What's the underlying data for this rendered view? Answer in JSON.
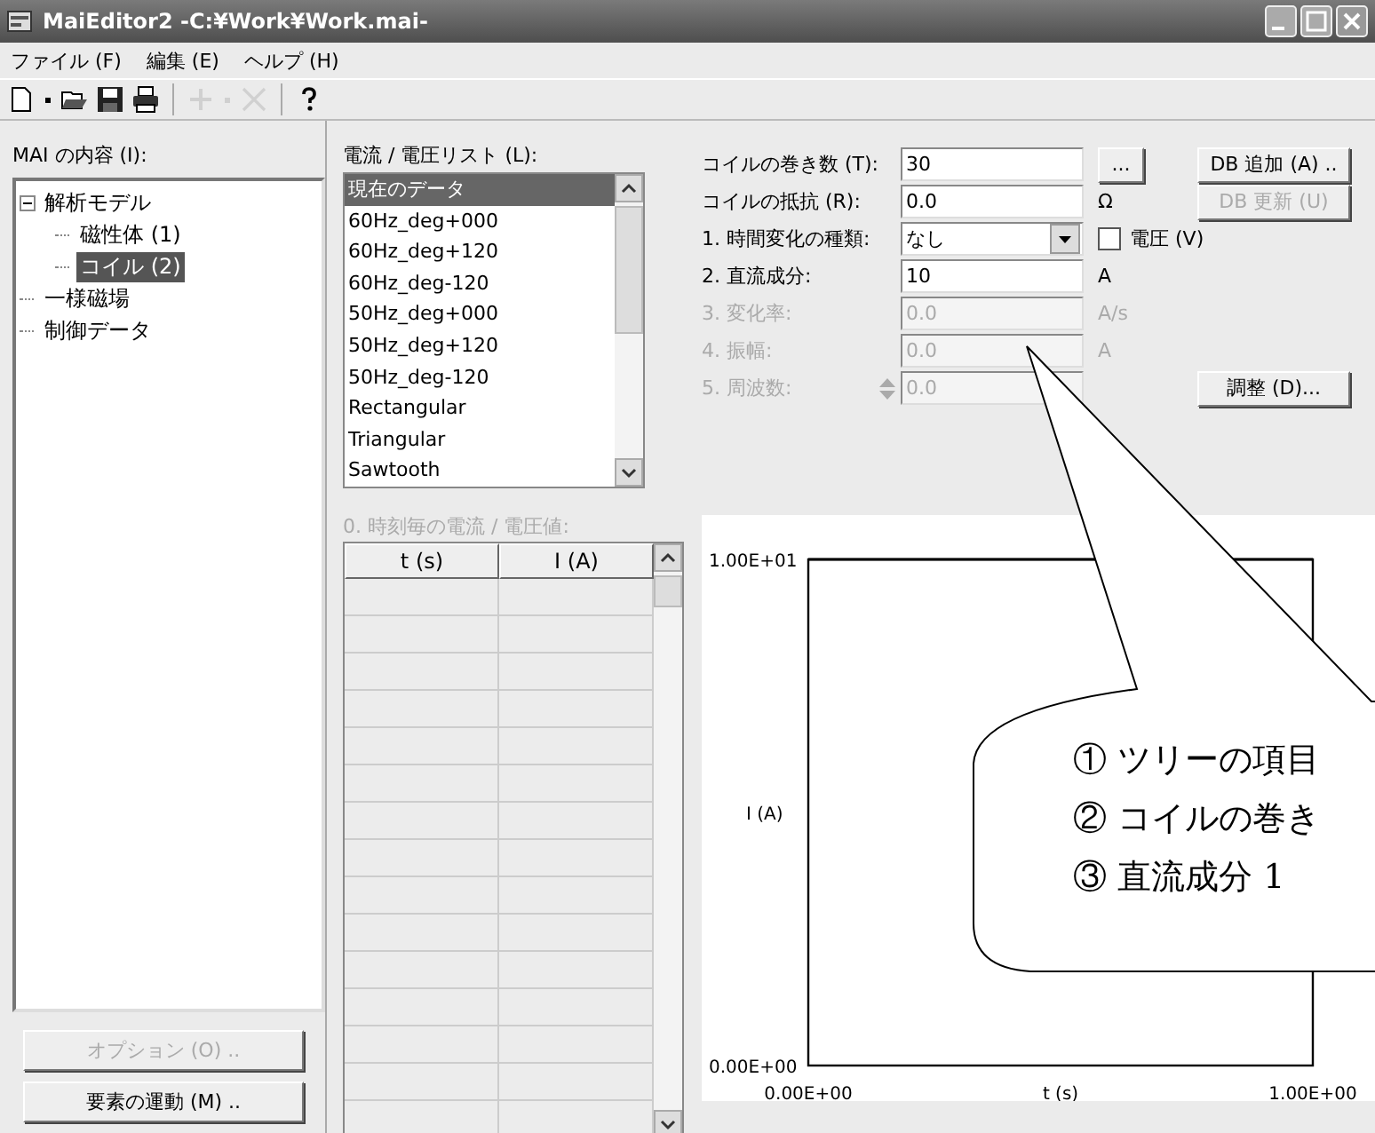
{
  "window": {
    "title": "MaiEditor2 -C:¥Work¥Work.mai-"
  },
  "menu": [
    {
      "label": "ファイル (F)"
    },
    {
      "label": "編集 (E)"
    },
    {
      "label": "ヘルプ (H)"
    }
  ],
  "toolbar": [
    {
      "kind": "new",
      "disabled": false
    },
    {
      "kind": "dropdown",
      "disabled": false
    },
    {
      "kind": "open",
      "disabled": false
    },
    {
      "kind": "save",
      "disabled": false
    },
    {
      "kind": "print",
      "disabled": false
    },
    {
      "kind": "separator"
    },
    {
      "kind": "add",
      "disabled": true
    },
    {
      "kind": "dropdown",
      "disabled": true
    },
    {
      "kind": "delete",
      "disabled": true
    },
    {
      "kind": "separator"
    },
    {
      "kind": "help",
      "disabled": false
    }
  ],
  "tree": {
    "label": "MAI の内容 (I):",
    "items": [
      {
        "label": "解析モデル",
        "expanded": true,
        "selected": false,
        "children": [
          {
            "label": "磁性体 (1)",
            "selected": false
          },
          {
            "label": "コイル (2)",
            "selected": true
          }
        ]
      },
      {
        "label": "一様磁場",
        "selected": false
      },
      {
        "label": "制御データ",
        "selected": false
      }
    ]
  },
  "left_buttons": [
    {
      "label": "オプション (O) ..",
      "disabled": true
    },
    {
      "label": "要素の運動 (M) ..",
      "disabled": false
    }
  ],
  "list": {
    "label": "電流 / 電圧リスト (L):",
    "items": [
      {
        "label": "現在のデータ",
        "selected": true
      },
      {
        "label": "60Hz_deg+000",
        "selected": false
      },
      {
        "label": "60Hz_deg+120",
        "selected": false
      },
      {
        "label": "60Hz_deg-120",
        "selected": false
      },
      {
        "label": "50Hz_deg+000",
        "selected": false
      },
      {
        "label": "50Hz_deg+120",
        "selected": false
      },
      {
        "label": "50Hz_deg-120",
        "selected": false
      },
      {
        "label": "Rectangular",
        "selected": false
      },
      {
        "label": "Triangular",
        "selected": false
      },
      {
        "label": "Sawtooth",
        "selected": false
      }
    ]
  },
  "form": {
    "rows": [
      {
        "kind": "text",
        "label": "コイルの巻き数 (T):",
        "value": "30",
        "disabled": false,
        "extra": {
          "kind": "button",
          "label": "..."
        },
        "side_button": {
          "label": "DB 追加 (A) ..",
          "disabled": false
        }
      },
      {
        "kind": "text",
        "label": "コイルの抵抗 (R):",
        "value": "0.0",
        "disabled": false,
        "extra": {
          "kind": "unit",
          "label": "Ω"
        },
        "side_button": {
          "label": "DB 更新 (U)",
          "disabled": true
        }
      },
      {
        "kind": "combo",
        "label": "1. 時間変化の種類:",
        "value": "なし",
        "disabled": false,
        "extra": {
          "kind": "checkbox",
          "label": "電圧 (V)",
          "checked": false
        }
      },
      {
        "kind": "text",
        "label": "2. 直流成分:",
        "value": "10",
        "disabled": false,
        "extra": {
          "kind": "unit",
          "label": "A"
        }
      },
      {
        "kind": "text",
        "label": "3. 変化率:",
        "value": "0.0",
        "disabled": true,
        "extra": {
          "kind": "unit",
          "label": "A/s"
        }
      },
      {
        "kind": "text",
        "label": "4. 振幅:",
        "value": "0.0",
        "disabled": true,
        "extra": {
          "kind": "unit",
          "label": "A"
        }
      },
      {
        "kind": "spin",
        "label": "5. 周波数:",
        "value": "0.0",
        "disabled": true,
        "side_button": {
          "label": "調整 (D)...",
          "disabled": false
        }
      }
    ]
  },
  "grid": {
    "label": "0. 時刻毎の電流 / 電圧値:",
    "disabled": true,
    "columns": [
      "t (s)",
      "I (A)"
    ]
  },
  "chart": {
    "chart_data": {
      "type": "line",
      "xlabel": "t (s)",
      "ylabel": "I (A)",
      "x": [
        0,
        1
      ],
      "series": [
        {
          "color": "#000000",
          "values": [
            10,
            10
          ]
        }
      ],
      "xlim": [
        0,
        1
      ],
      "ylim": [
        0,
        10
      ],
      "xticks": [
        {
          "value": 0,
          "label": "0.00E+00"
        },
        {
          "value": 1,
          "label": "1.00E+00"
        }
      ],
      "yticks": [
        {
          "value": 0,
          "label": "0.00E+00"
        },
        {
          "value": 10,
          "label": "1.00E+01"
        }
      ]
    }
  },
  "callout": {
    "lines": [
      "① ツリーの項目",
      "② コイルの巻き",
      "③ 直流成分 1"
    ]
  }
}
